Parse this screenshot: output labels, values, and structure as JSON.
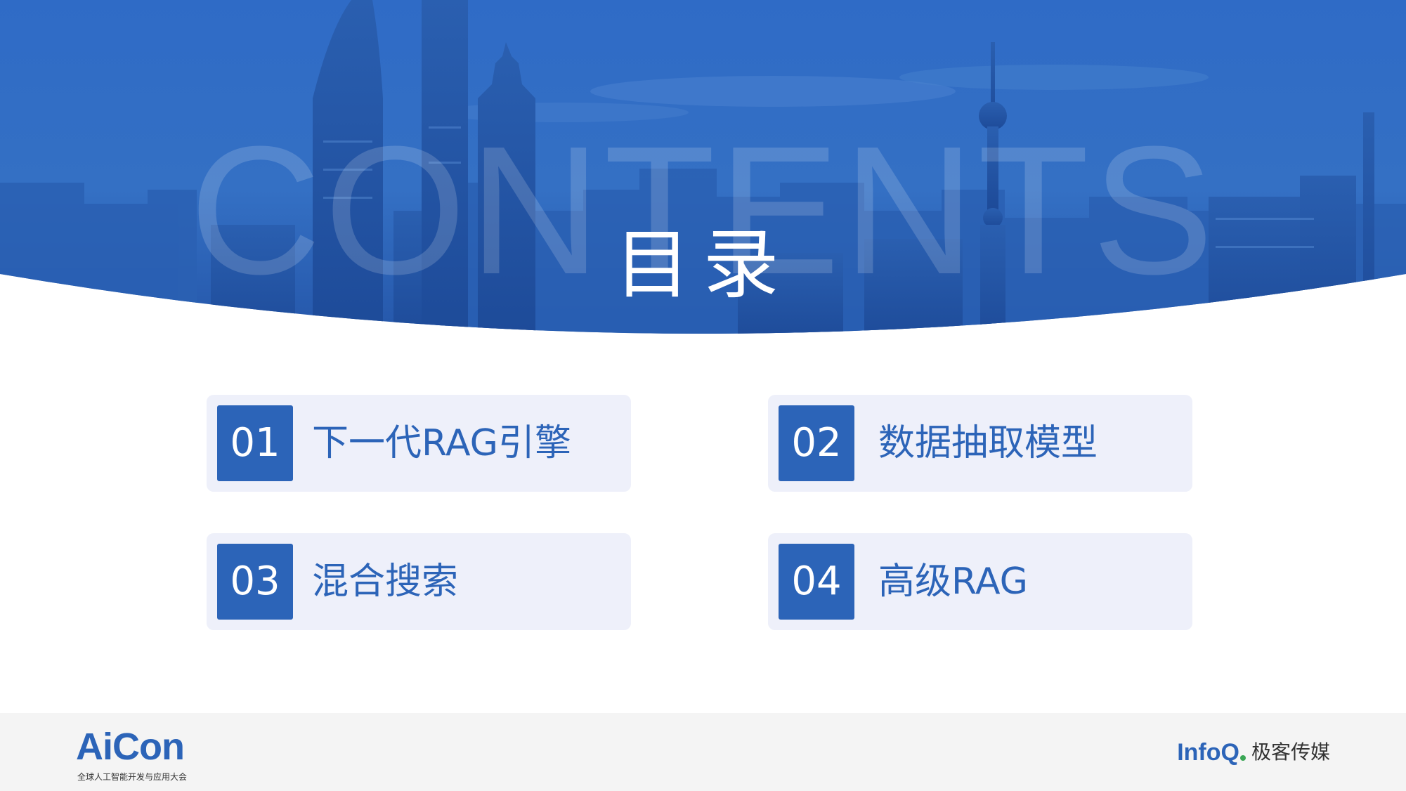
{
  "header": {
    "watermark": "CONTENTS",
    "title": "目录"
  },
  "toc": [
    {
      "num": "01",
      "label": "下一代RAG引擎"
    },
    {
      "num": "02",
      "label": "数据抽取模型"
    },
    {
      "num": "03",
      "label": "混合搜索"
    },
    {
      "num": "04",
      "label": "高级RAG"
    }
  ],
  "footer": {
    "left_logo": "AiCon",
    "left_logo_subtitle": "全球人工智能开发与应用大会",
    "right_logo_en": "InfoQ",
    "right_logo_cn": "极客传媒"
  },
  "colors": {
    "accent_blue": "#2c64b8",
    "card_bg": "#eef0fa",
    "footer_bg": "#f4f4f4",
    "infoq_green": "#3aa655"
  }
}
